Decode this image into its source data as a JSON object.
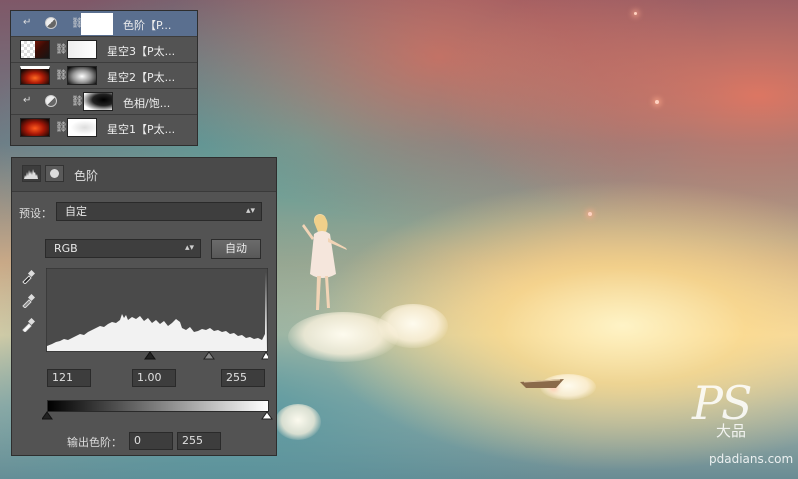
{
  "layers": [
    {
      "name": "色阶【P...",
      "selected": true,
      "clipped": true,
      "type": "adjustment"
    },
    {
      "name": "星空3【P太...",
      "selected": false,
      "clipped": false,
      "type": "image"
    },
    {
      "name": "星空2【P太...",
      "selected": false,
      "clipped": false,
      "type": "image"
    },
    {
      "name": "色相/饱...",
      "selected": false,
      "clipped": true,
      "type": "adjustment"
    },
    {
      "name": "星空1【P太...",
      "selected": false,
      "clipped": false,
      "type": "image"
    }
  ],
  "properties": {
    "title": "色阶",
    "preset_label": "预设：",
    "preset_value": "自定",
    "channel_value": "RGB",
    "auto_button": "自动",
    "input_black": "121",
    "input_gamma": "1.00",
    "input_white": "255",
    "output_label": "输出色阶：",
    "output_black": "0",
    "output_white": "255"
  },
  "watermark": {
    "logo": "PS",
    "sub": "大品",
    "url": "pdadians.com"
  },
  "colors": {
    "panel_bg": "#535353",
    "selected_layer": "#5a6f8f",
    "field_bg": "#3d3d3d"
  }
}
